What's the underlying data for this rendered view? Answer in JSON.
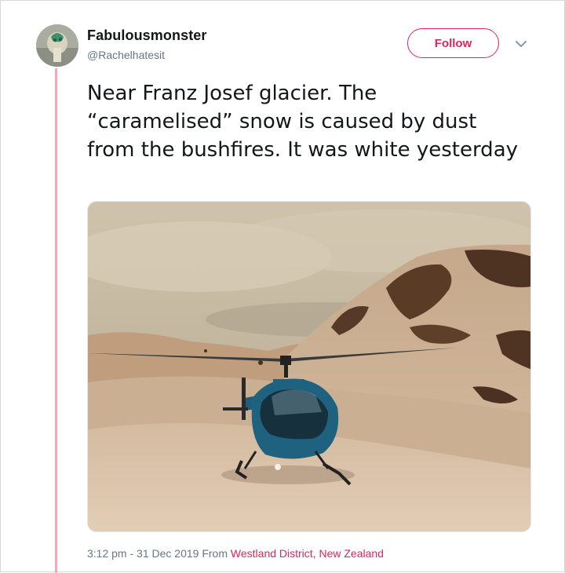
{
  "user": {
    "display_name": "Fabulousmonster",
    "handle": "@Rachelhatesit"
  },
  "actions": {
    "follow_label": "Follow"
  },
  "tweet": {
    "text": "Near Franz Josef glacier. The “caramelised” snow is caused by dust from the bushfires. It was white yesterday"
  },
  "meta": {
    "time": "3:12 pm",
    "separator": " - ",
    "date": "31 Dec 2019",
    "from_word": " From ",
    "location": "Westland District, New Zealand"
  },
  "colors": {
    "accent": "#e0245e",
    "thread_line": "#f3a8bd",
    "secondary_text": "#657786"
  },
  "icons": {
    "caret": "chevron-down-icon"
  }
}
